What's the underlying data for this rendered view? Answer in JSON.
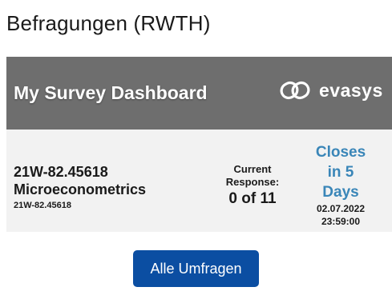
{
  "page": {
    "title": "Befragungen (RWTH)"
  },
  "header": {
    "dashboard_title": "My Survey Dashboard",
    "brand_name": "evasys",
    "brand_icon": "evasys-logo-icon",
    "background_color": "#6e6e6e"
  },
  "survey": {
    "code": "21W-82.45618",
    "name": "Microeconometrics",
    "sub_code": "21W-82.45618",
    "response_label_line1": "Current",
    "response_label_line2": "Response:",
    "response_count": "0 of 11",
    "closes_line1": "Closes",
    "closes_line2": "in 5",
    "closes_line3": "Days",
    "close_date": "02.07.2022",
    "close_time": "23:59:00",
    "closes_color": "#3a86b8"
  },
  "actions": {
    "all_surveys_label": "Alle Umfragen",
    "button_color": "#0b4ea2"
  }
}
